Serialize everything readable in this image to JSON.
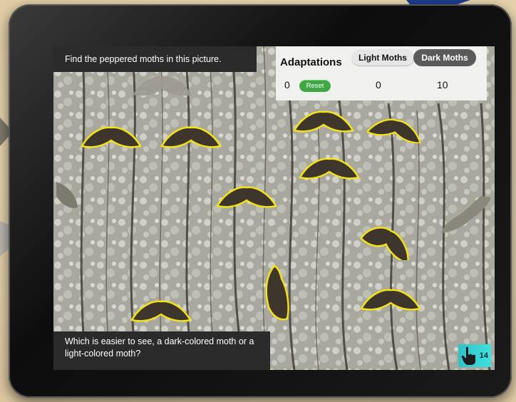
{
  "prompt": {
    "text": "Find the peppered moths in this picture."
  },
  "question": {
    "text": "Which is easier to see, a dark-colored moth or a light-colored moth?"
  },
  "score_panel": {
    "title": "Adaptations",
    "tabs": {
      "light": "Light Moths",
      "dark": "Dark Moths"
    },
    "reset_label": "Reset",
    "left_count": "0",
    "light_count": "0",
    "dark_count": "10"
  },
  "page_indicator": {
    "number": "14",
    "icon": "hand-pointer-icon"
  },
  "colors": {
    "highlight": "#f2e11b",
    "reset": "#3fa844",
    "badge": "#35cfd2",
    "bezel": "#1a1a1a"
  }
}
